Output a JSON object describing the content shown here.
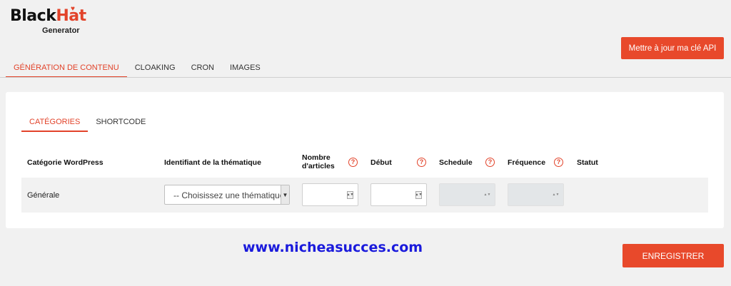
{
  "logo": {
    "brand_black": "Black",
    "brand_red": "Hat",
    "sub": "Generator"
  },
  "header": {
    "api_button": "Mettre à jour ma clé API"
  },
  "main_tabs": [
    {
      "label": "GÉNÉRATION DE CONTENU",
      "active": true
    },
    {
      "label": "CLOAKING",
      "active": false
    },
    {
      "label": "CRON",
      "active": false
    },
    {
      "label": "IMAGES",
      "active": false
    }
  ],
  "sub_tabs": [
    {
      "label": "CATÉGORIES",
      "active": true
    },
    {
      "label": "SHORTCODE",
      "active": false
    }
  ],
  "table": {
    "headers": {
      "category": "Catégorie WordPress",
      "theme_id": "Identifiant de la thématique",
      "articles_line1": "Nombre",
      "articles_line2": "d'articles",
      "start": "Début",
      "schedule": "Schedule",
      "frequency": "Fréquence",
      "status": "Statut"
    },
    "help_icon": "?",
    "row": {
      "category": "Générale",
      "theme_select": "-- Choisissez une thématique --",
      "articles": "",
      "start": "",
      "schedule": "",
      "frequency": "",
      "status": ""
    }
  },
  "watermark": "www.nicheasucces.com",
  "save_button": "ENREGISTRER",
  "colors": {
    "accent": "#e8492b",
    "watermark": "#1a1adc"
  }
}
